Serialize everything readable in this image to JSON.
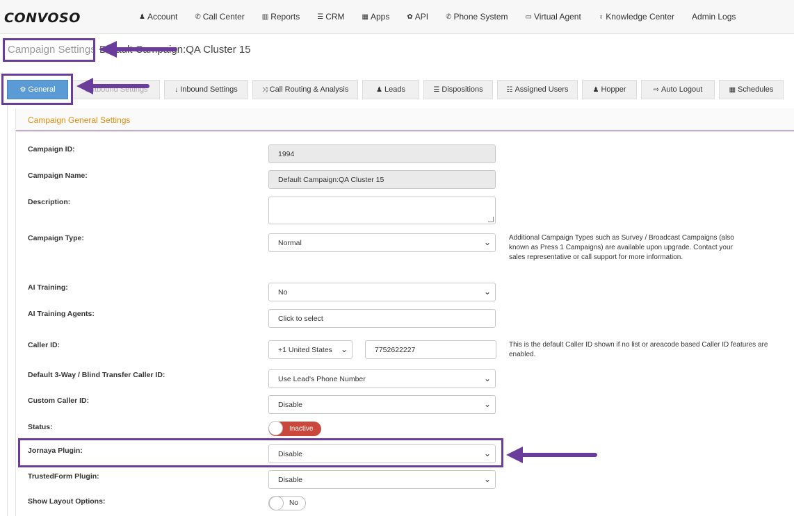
{
  "app": {
    "logo": "CONVOSO"
  },
  "nav": [
    {
      "icon": "user-icon",
      "glyph": "♟",
      "label": "Account"
    },
    {
      "icon": "phone-icon",
      "glyph": "✆",
      "label": "Call Center"
    },
    {
      "icon": "bar-chart-icon",
      "glyph": "▥",
      "label": "Reports"
    },
    {
      "icon": "list-icon",
      "glyph": "☰",
      "label": "CRM"
    },
    {
      "icon": "grid-icon",
      "glyph": "▦",
      "label": "Apps"
    },
    {
      "icon": "gear-icon",
      "glyph": "✿",
      "label": "API"
    },
    {
      "icon": "phone-icon",
      "glyph": "✆",
      "label": "Phone System"
    },
    {
      "icon": "monitor-icon",
      "glyph": "▭",
      "label": "Virtual Agent"
    },
    {
      "icon": "lightbulb-icon",
      "glyph": "♁",
      "label": "Knowledge Center"
    },
    {
      "icon": "",
      "glyph": "",
      "label": "Admin Logs"
    }
  ],
  "header": {
    "page_title": "Campaign Settings",
    "campaign_title": "Default Campaign:QA Cluster 15"
  },
  "tabs": {
    "general": "General",
    "outbound": "Outbound Settings",
    "inbound": "Inbound Settings",
    "routing": "Call Routing & Analysis",
    "leads": "Leads",
    "dispositions": "Dispositions",
    "assigned": "Assigned Users",
    "hopper": "Hopper",
    "autologout": "Auto Logout",
    "schedules": "Schedules"
  },
  "panel": {
    "title": "Campaign General Settings"
  },
  "fields": {
    "campaign_id": {
      "label": "Campaign ID:",
      "value": "1994"
    },
    "campaign_name": {
      "label": "Campaign Name:",
      "value": "Default Campaign:QA Cluster 15"
    },
    "description": {
      "label": "Description:",
      "value": ""
    },
    "campaign_type": {
      "label": "Campaign Type:",
      "value": "Normal",
      "note": "Additional Campaign Types such as Survey / Broadcast Campaigns (also known as Press 1 Campaigns) are available upon upgrade. Contact your sales representative or call support for more information."
    },
    "ai_training": {
      "label": "AI Training:",
      "value": "No"
    },
    "ai_training_agents": {
      "label": "AI Training Agents:",
      "placeholder": "Click to select"
    },
    "caller_id": {
      "label": "Caller ID:",
      "country": "+1 United States",
      "number": "7752622227",
      "note": "This is the default Caller ID shown if no list or areacode based Caller ID features are enabled."
    },
    "transfer_caller_id": {
      "label": "Default 3-Way / Blind Transfer Caller ID:",
      "value": "Use Lead's Phone Number"
    },
    "custom_caller_id": {
      "label": "Custom Caller ID:",
      "value": "Disable"
    },
    "status": {
      "label": "Status:",
      "value": "Inactive"
    },
    "jornaya": {
      "label": "Jornaya Plugin:",
      "value": "Disable"
    },
    "trustedform": {
      "label": "TrustedForm Plugin:",
      "value": "Disable"
    },
    "layout_options": {
      "label": "Show Layout Options:",
      "value": "No"
    }
  },
  "colors": {
    "accent": "#6a3d9a",
    "active_tab": "#5b9bd5",
    "panel_title": "#e08e0b",
    "inactive": "#c9483b"
  }
}
